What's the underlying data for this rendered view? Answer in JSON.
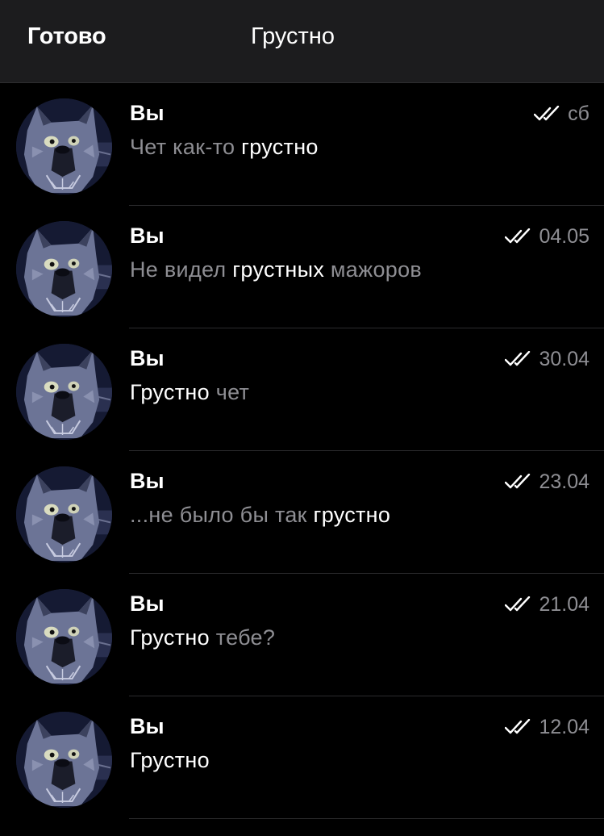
{
  "header": {
    "done_label": "Готово",
    "query": "Грустно"
  },
  "colors": {
    "header_bg": "#1c1c1e",
    "page_bg": "#000000",
    "secondary_text": "#8e8e93",
    "primary_text": "#ffffff"
  },
  "results": [
    {
      "sender": "Вы",
      "date": "сб",
      "status_icon": "double-check-icon",
      "avatar_icon": "wolf-avatar-icon",
      "preview": [
        {
          "text": "Чет как-то ",
          "hl": false
        },
        {
          "text": "грустно",
          "hl": true
        }
      ]
    },
    {
      "sender": "Вы",
      "date": "04.05",
      "status_icon": "double-check-icon",
      "avatar_icon": "wolf-avatar-icon",
      "preview": [
        {
          "text": "Не видел ",
          "hl": false
        },
        {
          "text": "грустных",
          "hl": true
        },
        {
          "text": " мажоров",
          "hl": false
        }
      ]
    },
    {
      "sender": "Вы",
      "date": "30.04",
      "status_icon": "double-check-icon",
      "avatar_icon": "wolf-avatar-icon",
      "preview": [
        {
          "text": "Грустно",
          "hl": true
        },
        {
          "text": " чет",
          "hl": false
        }
      ]
    },
    {
      "sender": "Вы",
      "date": "23.04",
      "status_icon": "double-check-icon",
      "avatar_icon": "wolf-avatar-icon",
      "preview": [
        {
          "text": "...не было бы так ",
          "hl": false
        },
        {
          "text": "грустно",
          "hl": true
        }
      ]
    },
    {
      "sender": "Вы",
      "date": "21.04",
      "status_icon": "double-check-icon",
      "avatar_icon": "wolf-avatar-icon",
      "preview": [
        {
          "text": "Грустно",
          "hl": true
        },
        {
          "text": " тебе?",
          "hl": false
        }
      ]
    },
    {
      "sender": "Вы",
      "date": "12.04",
      "status_icon": "double-check-icon",
      "avatar_icon": "wolf-avatar-icon",
      "preview": [
        {
          "text": "Грустно",
          "hl": true
        }
      ]
    }
  ]
}
